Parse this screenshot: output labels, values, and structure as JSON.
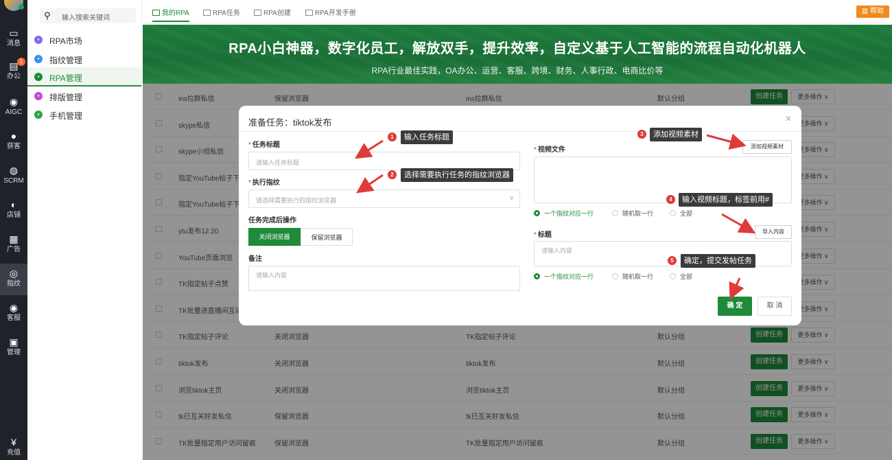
{
  "rail": {
    "items": [
      {
        "label": "消息",
        "icon": "chat-icon"
      },
      {
        "label": "办公",
        "icon": "office-icon",
        "badge": "1"
      },
      {
        "label": "AIGC",
        "icon": "aigc-icon"
      },
      {
        "label": "获客",
        "icon": "user-icon"
      },
      {
        "label": "SCRM",
        "icon": "scrm-icon"
      },
      {
        "label": "店铺",
        "icon": "store-icon"
      },
      {
        "label": "广告",
        "icon": "ads-icon"
      },
      {
        "label": "指纹",
        "icon": "fingerprint-icon"
      },
      {
        "label": "客服",
        "icon": "service-icon"
      },
      {
        "label": "管理",
        "icon": "grid-icon"
      },
      {
        "label": "充值",
        "icon": "recharge-icon"
      }
    ]
  },
  "sidebar": {
    "search_placeholder": "输入搜索关键词",
    "items": [
      {
        "label": "RPA市场",
        "color": "#7a6ff0"
      },
      {
        "label": "指纹管理",
        "color": "#3b8ff0"
      },
      {
        "label": "RPA管理",
        "color": "#1e8a3a"
      },
      {
        "label": "排版管理",
        "color": "#c04ad8"
      },
      {
        "label": "手机管理",
        "color": "#2aa84a"
      }
    ]
  },
  "tabs": [
    "我的RPA",
    "RPA任务",
    "RPA创建",
    "RPA开发手册"
  ],
  "help_label": "帮助",
  "banner": {
    "title": "RPA小白神器，数字化员工，解放双手，提升效率，自定义基于人工智能的流程自动化机器人",
    "subtitle": "RPA行业最佳实践，OA办公、运营、客服、跨境、财务、人事行政、电商比价等"
  },
  "table": {
    "create_label": "创建任务",
    "more_label": "更多操作 ∨",
    "rows": [
      {
        "name": "ins拉群私信",
        "browser": "保留浏览器",
        "task": "ins拉群私信",
        "group": "默认分组"
      },
      {
        "name": "skype私信",
        "browser": "",
        "task": "",
        "group": ""
      },
      {
        "name": "skype小组私信",
        "browser": "",
        "task": "",
        "group": ""
      },
      {
        "name": "指定YouTube帖子下方",
        "browser": "",
        "task": "",
        "group": ""
      },
      {
        "name": "指定YouTube帖子下方",
        "browser": "",
        "task": "",
        "group": ""
      },
      {
        "name": "ytu发布12.20",
        "browser": "",
        "task": "",
        "group": ""
      },
      {
        "name": "YouTube页面浏览",
        "browser": "",
        "task": "",
        "group": ""
      },
      {
        "name": "TK指定帖子点赞",
        "browser": "",
        "task": "",
        "group": ""
      },
      {
        "name": "TK批量进直播间互动",
        "browser": "",
        "task": "",
        "group": ""
      },
      {
        "name": "TK指定帖子评论",
        "browser": "关闭浏览器",
        "task": "TK指定帖子评论",
        "group": "默认分组"
      },
      {
        "name": "tiktok发布",
        "browser": "关闭浏览器",
        "task": "tiktok发布",
        "group": "默认分组"
      },
      {
        "name": "浏览tiktok主页",
        "browser": "关闭浏览器",
        "task": "浏览tiktok主页",
        "group": "默认分组"
      },
      {
        "name": "tk已互关好友私信",
        "browser": "保留浏览器",
        "task": "tk已互关好友私信",
        "group": "默认分组"
      },
      {
        "name": "TK批量指定用户访问留痕",
        "browser": "保留浏览器",
        "task": "TK批量指定用户访问留痕",
        "group": "默认分组"
      }
    ]
  },
  "modal": {
    "title": "准备任务：tiktok发布",
    "task_title_label": "任务标题",
    "task_title_placeholder": "请输入任务标题",
    "fingerprint_label": "执行指纹",
    "fingerprint_placeholder": "请选择需要执行的指纹浏览器",
    "after_label": "任务完成后操作",
    "close_browser": "关闭浏览器",
    "keep_browser": "保留浏览器",
    "remark_label": "备注",
    "remark_placeholder": "请输入内容",
    "video_label": "视频文件",
    "add_video": "添加视频素材",
    "radio_opts": [
      "一个指纹对应一行",
      "随机取一行",
      "全部"
    ],
    "title_label": "标题",
    "import_label": "导入内容",
    "title_placeholder": "请输入内容",
    "ok": "确 定",
    "cancel": "取 消"
  },
  "annotations": [
    {
      "num": "1",
      "text": "输入任务标题"
    },
    {
      "num": "2",
      "text": "选择需要执行任务的指纹浏览器"
    },
    {
      "num": "3",
      "text": "添加视频素材"
    },
    {
      "num": "4",
      "text": "输入视频标题，标签前用#"
    },
    {
      "num": "5",
      "text": "确定，提交发帖任务"
    }
  ]
}
